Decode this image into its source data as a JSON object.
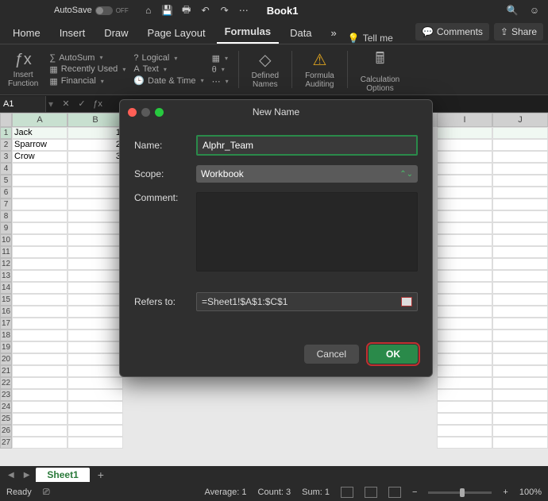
{
  "titlebar": {
    "autosave_label": "AutoSave",
    "autosave_state": "OFF",
    "doc_title": "Book1"
  },
  "tabs": {
    "items": [
      "Home",
      "Insert",
      "Draw",
      "Page Layout",
      "Formulas",
      "Data"
    ],
    "active": "Formulas",
    "overflow": "»",
    "tellme_label": "Tell me",
    "comments_label": "Comments",
    "share_label": "Share"
  },
  "ribbon": {
    "insert_function": "Insert Function",
    "autosum": "AutoSum",
    "recently_used": "Recently Used",
    "financial": "Financial",
    "logical": "Logical",
    "text": "Text",
    "date_time": "Date & Time",
    "defined_names": "Defined Names",
    "formula_auditing": "Formula Auditing",
    "calculation_options": "Calculation Options"
  },
  "fbar": {
    "namebox": "A1"
  },
  "grid": {
    "cols": [
      "A",
      "B",
      "I",
      "J"
    ],
    "rows": [
      {
        "n": "1",
        "a": "Jack",
        "b": "1"
      },
      {
        "n": "2",
        "a": "Sparrow",
        "b": "2"
      },
      {
        "n": "3",
        "a": "Crow",
        "b": "3"
      }
    ]
  },
  "modal": {
    "title": "New Name",
    "name_label": "Name:",
    "name_value": "Alphr_Team",
    "scope_label": "Scope:",
    "scope_value": "Workbook",
    "comment_label": "Comment:",
    "refers_label": "Refers to:",
    "refers_value": "=Sheet1!$A$1:$C$1",
    "cancel": "Cancel",
    "ok": "OK"
  },
  "sheets": {
    "active": "Sheet1"
  },
  "status": {
    "ready": "Ready",
    "average": "Average: 1",
    "count": "Count: 3",
    "sum": "Sum: 1",
    "zoom": "100%"
  }
}
